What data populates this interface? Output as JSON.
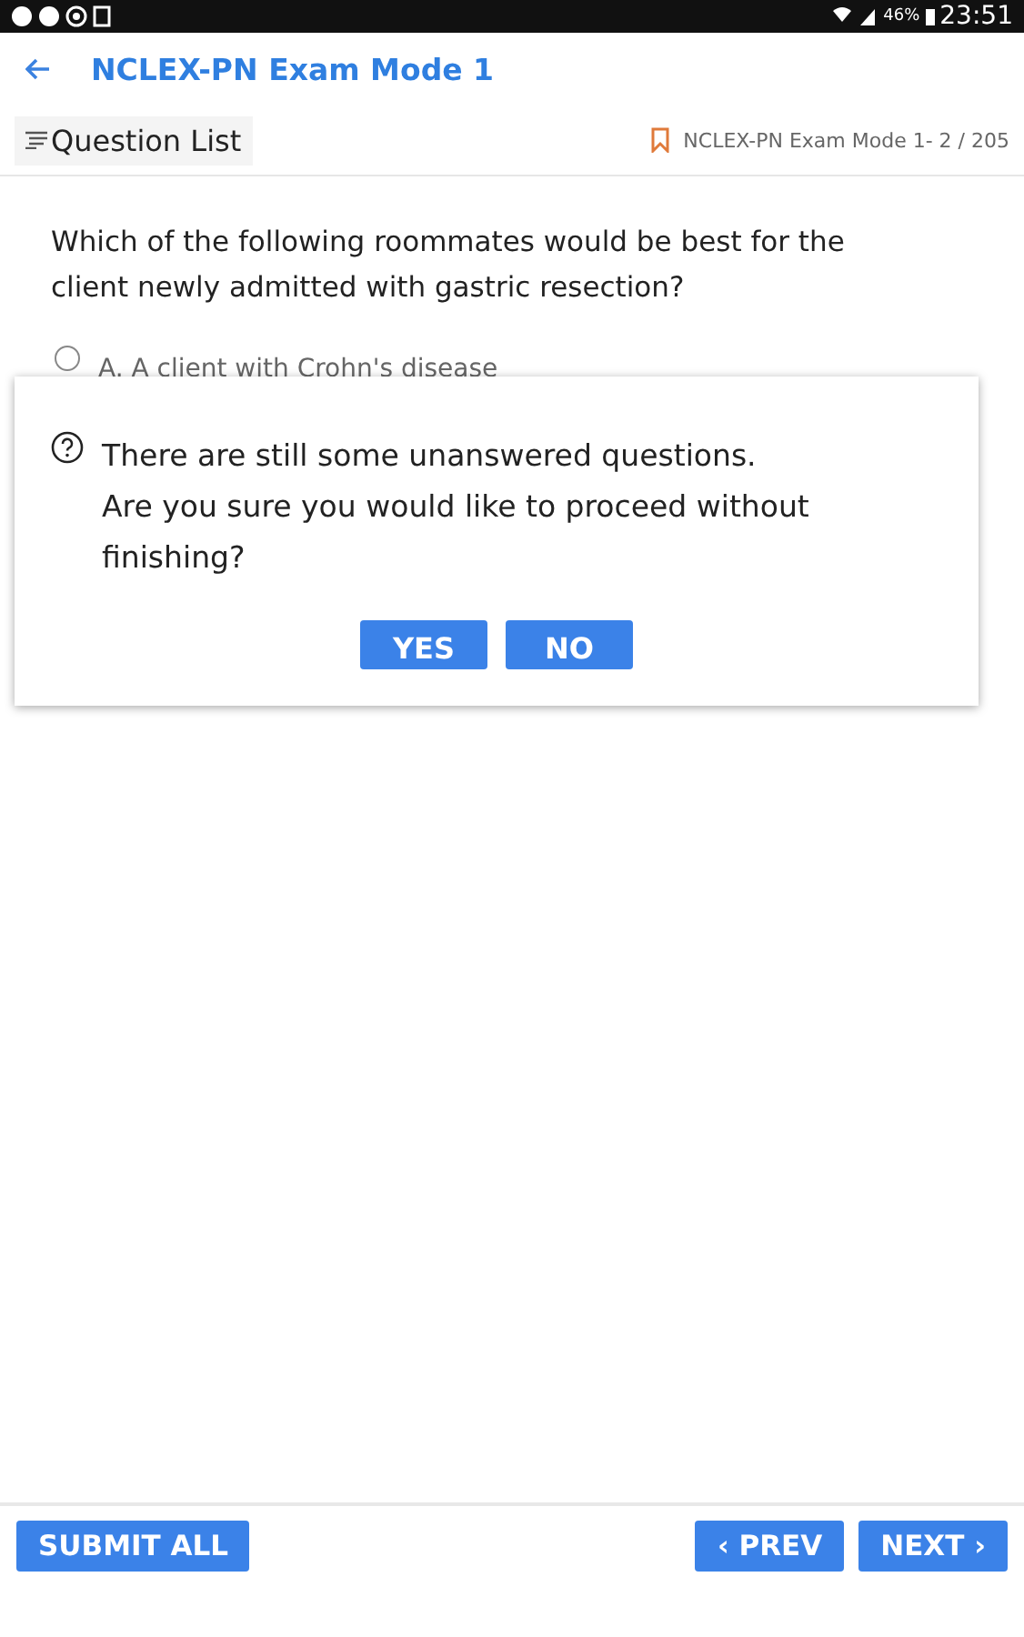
{
  "status_bar": {
    "battery": "46%",
    "time": "23:51"
  },
  "app_bar": {
    "title": "NCLEX-PN Exam Mode 1"
  },
  "toolbar": {
    "question_list": "Question List",
    "progress": "NCLEX-PN Exam Mode 1- 2 / 205"
  },
  "question": {
    "text": "Which of the following roommates would be best for the client newly admitted with gastric resection?",
    "options": [
      {
        "label": "A. A client with Crohn's disease",
        "selected": false
      }
    ]
  },
  "dialog": {
    "message": [
      "There are still some unanswered questions.",
      "Are you sure you would like to proceed without finishing?"
    ],
    "buttons": [
      "YES",
      "NO"
    ]
  },
  "footer": {
    "submit": "SUBMIT ALL",
    "prev": "PREV",
    "next": "NEXT",
    "prev_glyph": "‹",
    "next_glyph": "›"
  }
}
